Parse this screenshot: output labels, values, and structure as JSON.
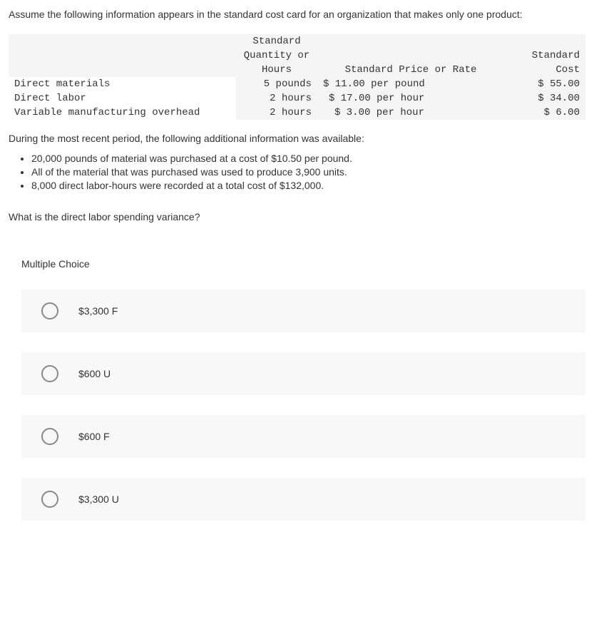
{
  "intro": "Assume the following information appears in the standard cost card for an organization that makes only one product:",
  "table": {
    "headers": {
      "qty_line1": "Standard",
      "qty_line2": "Quantity or",
      "qty_line3": "Hours",
      "rate": "Standard Price or Rate",
      "cost_line1": "Standard",
      "cost_line2": "Cost"
    },
    "rows": [
      {
        "label": "Direct materials",
        "qty": "5 pounds",
        "rate": "$ 11.00 per pound",
        "cost": "$ 55.00"
      },
      {
        "label": "Direct labor",
        "qty": "2 hours",
        "rate": "$ 17.00 per hour",
        "cost": "$ 34.00"
      },
      {
        "label": "Variable manufacturing overhead",
        "qty": "2 hours",
        "rate": "$ 3.00 per hour",
        "cost": "$ 6.00"
      }
    ]
  },
  "additional_intro": "During the most recent period, the following additional information was available:",
  "bullets": [
    "20,000 pounds of material was purchased at a cost of $10.50 per pound.",
    "All of the material that was purchased was used to produce 3,900 units.",
    "8,000 direct labor-hours were recorded at a total cost of $132,000."
  ],
  "question": "What is the direct labor spending variance?",
  "mc_label": "Multiple Choice",
  "choices": [
    "$3,300 F",
    "$600 U",
    "$600 F",
    "$3,300 U"
  ]
}
